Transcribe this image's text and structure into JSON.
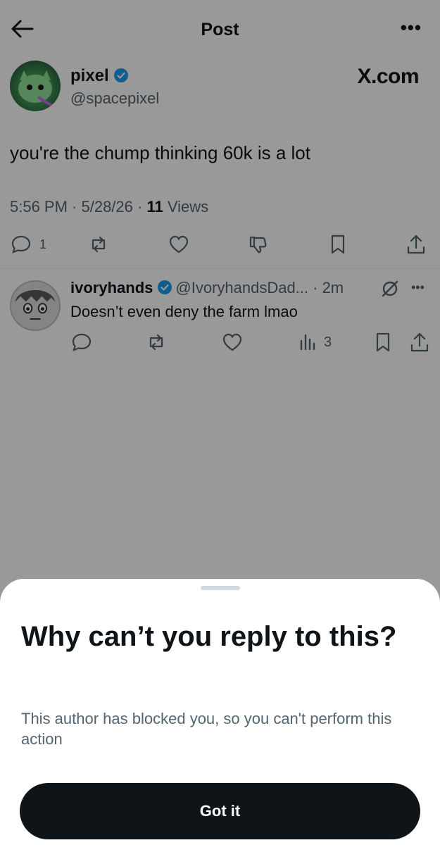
{
  "header": {
    "title": "Post"
  },
  "post": {
    "author_name": "pixel",
    "author_handle": "@spacepixel",
    "watermark": "X.com",
    "text": "you're the chump thinking 60k is a lot",
    "timestamp": "5:56 PM · 5/28/26 · ",
    "views_count": "11",
    "views_label": " Views",
    "reply_count": "1"
  },
  "reply": {
    "author_name": "ivoryhands",
    "author_handle": "@IvoryhandsDad... · 2m",
    "text": "Doesn’t even deny the farm lmao",
    "views_count": "3"
  },
  "sheet": {
    "title": "Why can’t you reply to this?",
    "body": "This author has blocked you, so you can't perform this action",
    "button_label": "Got it"
  },
  "colors": {
    "verified": "#1d9bf0",
    "button_bg": "#0f1419",
    "muted_text": "#536471"
  }
}
